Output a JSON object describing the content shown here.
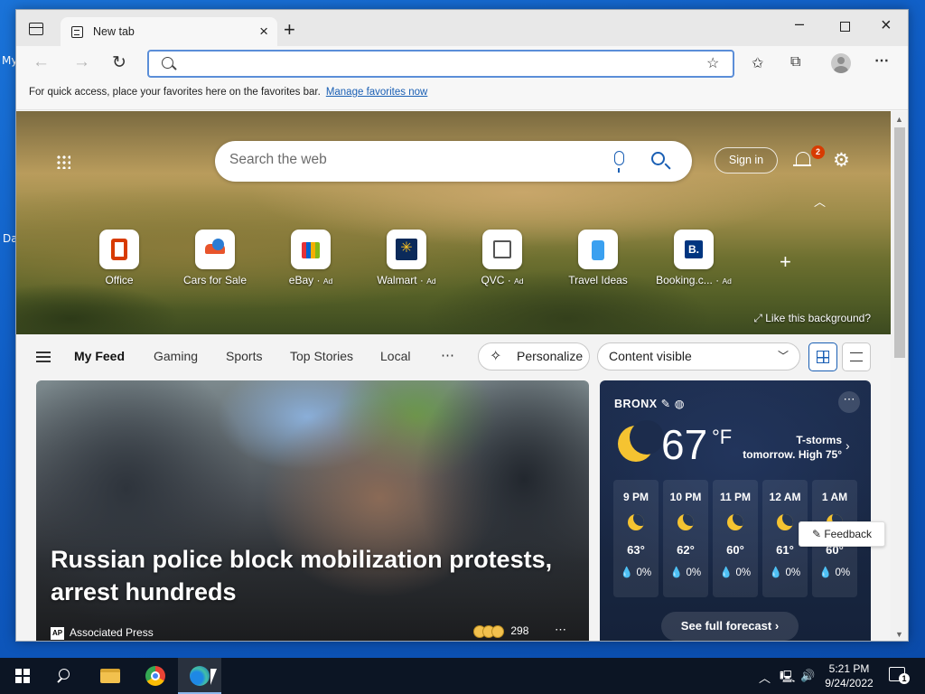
{
  "desktop": {
    "label_1": "My",
    "label_2": "Da"
  },
  "browser": {
    "tab_title": "New tab",
    "address_placeholder": "",
    "favorites_prompt": "For quick access, place your favorites here on the favorites bar.",
    "favorites_link": "Manage favorites now"
  },
  "hero": {
    "search_placeholder": "Search the web",
    "sign_in": "Sign in",
    "notification_count": "2",
    "like_background": "Like this background?",
    "quick_links": [
      {
        "label": "Office",
        "ad": "",
        "icon": "office-icon"
      },
      {
        "label": "Cars for Sale",
        "ad": "",
        "icon": "car-icon"
      },
      {
        "label": "eBay",
        "ad": "Ad",
        "icon": "ebay-icon"
      },
      {
        "label": "Walmart",
        "ad": "Ad",
        "icon": "walmart-icon"
      },
      {
        "label": "QVC",
        "ad": "Ad",
        "icon": "qvc-icon"
      },
      {
        "label": "Travel Ideas",
        "ad": "",
        "icon": "luggage-icon"
      },
      {
        "label": "Booking.c...",
        "ad": "Ad",
        "icon": "booking-icon"
      }
    ]
  },
  "feed": {
    "tabs": [
      "My Feed",
      "Gaming",
      "Sports",
      "Top Stories",
      "Local"
    ],
    "personalize": "Personalize",
    "content_visibility": "Content visible"
  },
  "news": {
    "title": "Russian police block mobilization protests, arrest hundreds",
    "source": "Associated Press",
    "source_badge": "AP",
    "reactions": "298"
  },
  "weather": {
    "location": "BRONX",
    "temperature": "67",
    "unit": "°F",
    "forecast_line1": "T-storms",
    "forecast_line2": "tomorrow. High 75°",
    "hourly": [
      {
        "time": "9 PM",
        "temp": "63°",
        "precip": "0%"
      },
      {
        "time": "10 PM",
        "temp": "62°",
        "precip": "0%"
      },
      {
        "time": "11 PM",
        "temp": "60°",
        "precip": "0%"
      },
      {
        "time": "12 AM",
        "temp": "61°",
        "precip": "0%"
      },
      {
        "time": "1 AM",
        "temp": "60°",
        "precip": "0%"
      }
    ],
    "full_forecast": "See full forecast"
  },
  "feedback": "Feedback",
  "taskbar": {
    "time": "5:21 PM",
    "date": "9/24/2022",
    "notification_count": "1"
  },
  "colors": {
    "accent": "#1a5fb4",
    "notification_badge": "#d83b01",
    "weather_bg": "#1c2c4c",
    "taskbar": "#0c1524"
  }
}
